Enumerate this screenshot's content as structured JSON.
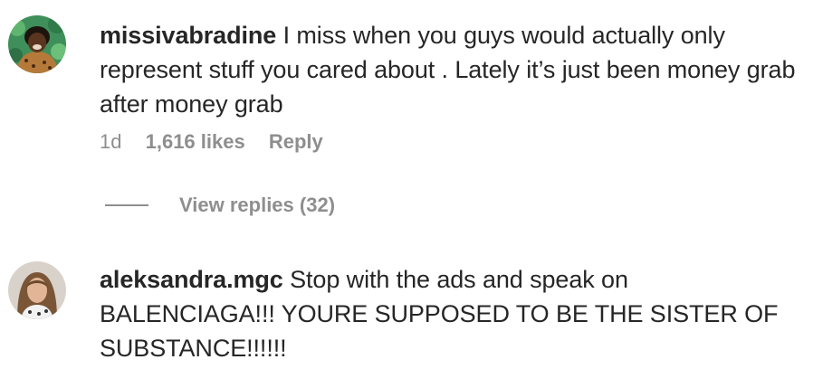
{
  "comments": [
    {
      "username": "missivabradine",
      "text": "I miss when you guys would actually only represent stuff you cared about . Lately it’s just been money grab after money grab",
      "time": "1d",
      "likes": "1,616 likes",
      "reply_label": "Reply",
      "view_replies": "View replies (32)"
    },
    {
      "username": "aleksandra.mgc",
      "text": "Stop with the ads and speak on BALENCIAGA!!! YOURE SUPPOSED TO BE THE SISTER OF SUBSTANCE!!!!!!"
    }
  ],
  "colors": {
    "text": "#262626",
    "secondary": "#8e8e8e",
    "background": "#ffffff"
  }
}
